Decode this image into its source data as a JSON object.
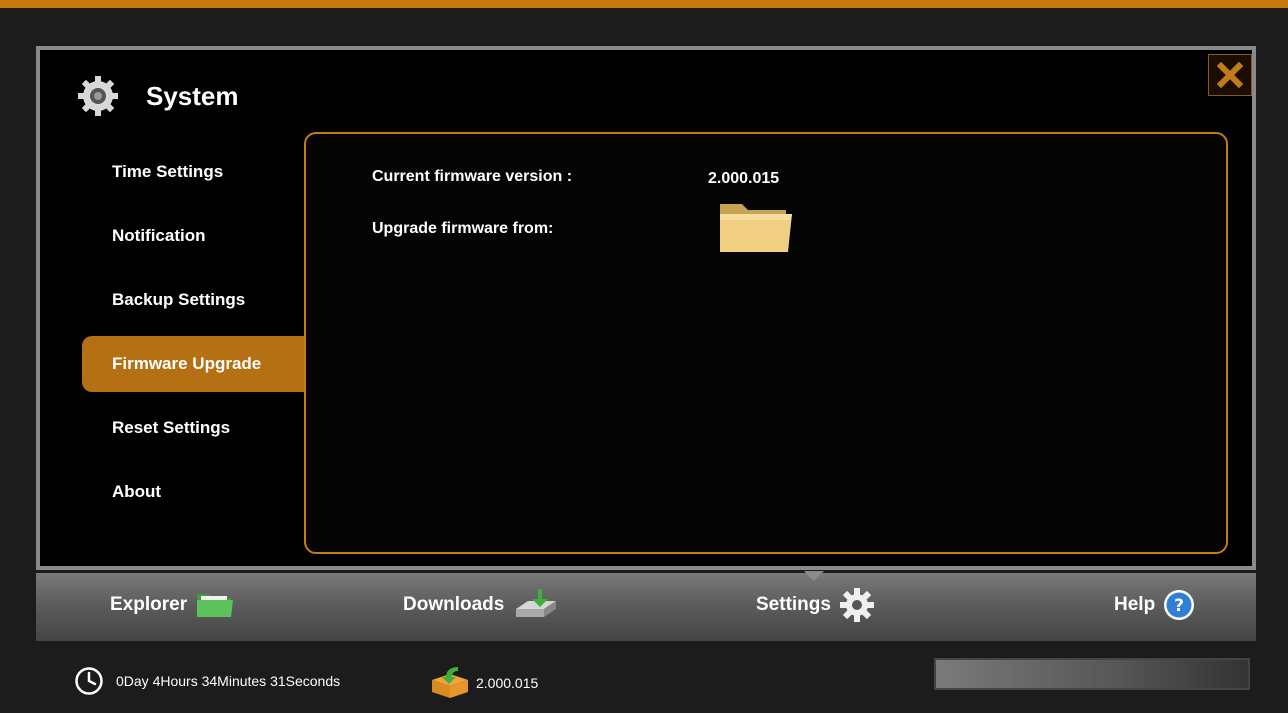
{
  "window": {
    "title": "System",
    "nav_items": [
      {
        "label": "Time Settings"
      },
      {
        "label": "Notification"
      },
      {
        "label": "Backup Settings"
      },
      {
        "label": "Firmware Upgrade",
        "active": true
      },
      {
        "label": "Reset Settings"
      },
      {
        "label": "About"
      }
    ],
    "panel": {
      "current_label": "Current firmware version :",
      "current_value": "2.000.015",
      "upgrade_label": "Upgrade firmware from:"
    }
  },
  "bottom_tabs": [
    {
      "label": "Explorer",
      "icon": "folder-icon"
    },
    {
      "label": "Downloads",
      "icon": "download-drive-icon"
    },
    {
      "label": "Settings",
      "icon": "gear-icon",
      "active": true
    },
    {
      "label": "Help",
      "icon": "help-icon"
    }
  ],
  "status": {
    "uptime": "0Day 4Hours 34Minutes 31Seconds",
    "version": "2.000.015"
  },
  "colors": {
    "accent": "#c7790f",
    "active_nav": "#b57014",
    "panel_border": "#c27d18",
    "help_blue": "#2f7fd6"
  }
}
